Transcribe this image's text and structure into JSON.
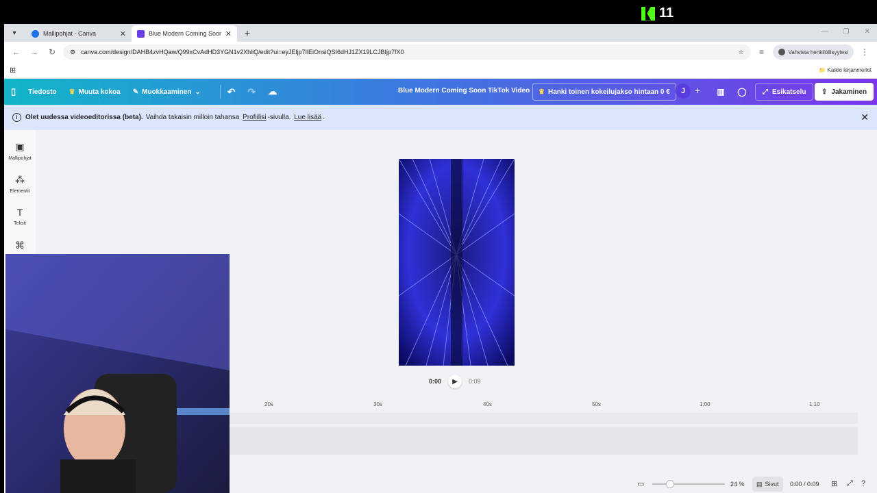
{
  "overlay": {
    "viewer_count": "11"
  },
  "browser": {
    "tabs": [
      {
        "title": "Mallipohjat - Canva",
        "active": false
      },
      {
        "title": "Blue Modern Coming Soon Tik",
        "active": true
      }
    ],
    "url": "canva.com/design/DAHB4zvHQaw/Q99xCvAdHD3YGN1v2XhliQ/edit?ui=eyJEljp7IlEiOnsiQSI6dHJ1ZX19LCJBIjp7fX0",
    "profile_label": "Vahvista henkilöllisyytesi",
    "bookmarks_label": "Kaikki kirjanmerkit"
  },
  "toolbar": {
    "file": "Tiedosto",
    "resize": "Muuta kokoa",
    "edit": "Muokkaaminen",
    "design_title": "Blue Modern Coming Soon TikTok Video",
    "trial": "Hanki toinen kokeilujakso hintaan 0 €",
    "avatar_initial": "J",
    "preview": "Esikatselu",
    "share": "Jakaminen"
  },
  "banner": {
    "bold": "Olet uudessa videoeditorissa (beta).",
    "text1": "Vaihda takaisin milloin tahansa",
    "link1": "Profiilisi",
    "text2": "-sivulla.",
    "link2": "Lue lisää",
    "text3": "."
  },
  "sidebar": {
    "items": [
      {
        "label": "Mallipohjat",
        "icon": "templates-icon"
      },
      {
        "label": "Elementit",
        "icon": "elements-icon"
      },
      {
        "label": "Teksti",
        "icon": "text-icon"
      },
      {
        "label": "",
        "icon": "brand-icon"
      }
    ]
  },
  "player": {
    "current": "0:00",
    "duration": "0:09"
  },
  "timeline": {
    "ticks": [
      "20s",
      "30s",
      "40s",
      "50s",
      "1:00",
      "1:10"
    ]
  },
  "bottom": {
    "zoom": "24 %",
    "pages": "Sivut",
    "time": "0:00 / 0:09"
  }
}
